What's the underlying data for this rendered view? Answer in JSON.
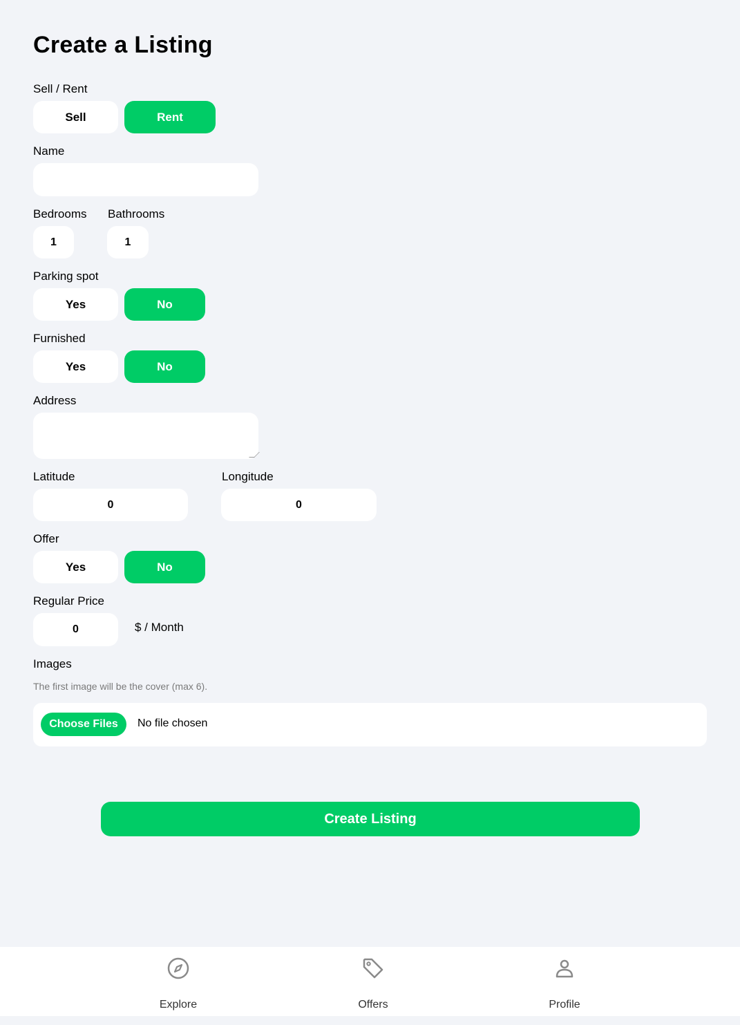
{
  "page": {
    "title": "Create a Listing"
  },
  "type_field": {
    "label": "Sell / Rent",
    "options": [
      "Sell",
      "Rent"
    ],
    "selected": "Rent"
  },
  "name_field": {
    "label": "Name",
    "value": ""
  },
  "bedrooms_field": {
    "label": "Bedrooms",
    "value": "1"
  },
  "bathrooms_field": {
    "label": "Bathrooms",
    "value": "1"
  },
  "parking_field": {
    "label": "Parking spot",
    "yes": "Yes",
    "no": "No",
    "selected": "No"
  },
  "furnished_field": {
    "label": "Furnished",
    "yes": "Yes",
    "no": "No",
    "selected": "No"
  },
  "address_field": {
    "label": "Address",
    "value": ""
  },
  "latitude_field": {
    "label": "Latitude",
    "value": "0"
  },
  "longitude_field": {
    "label": "Longitude",
    "value": "0"
  },
  "offer_field": {
    "label": "Offer",
    "yes": "Yes",
    "no": "No",
    "selected": "No"
  },
  "price_field": {
    "label": "Regular Price",
    "value": "0",
    "unit": "$ / Month"
  },
  "images_field": {
    "label": "Images",
    "hint": "The first image will be the cover (max 6).",
    "choose_label": "Choose Files",
    "status": "No file chosen"
  },
  "submit_label": "Create Listing",
  "navbar": {
    "items": [
      {
        "label": "Explore",
        "icon": "compass-icon"
      },
      {
        "label": "Offers",
        "icon": "tag-icon"
      },
      {
        "label": "Profile",
        "icon": "person-icon"
      }
    ]
  },
  "colors": {
    "accent": "#00cc66",
    "background": "#f2f4f8",
    "surface": "#ffffff"
  }
}
